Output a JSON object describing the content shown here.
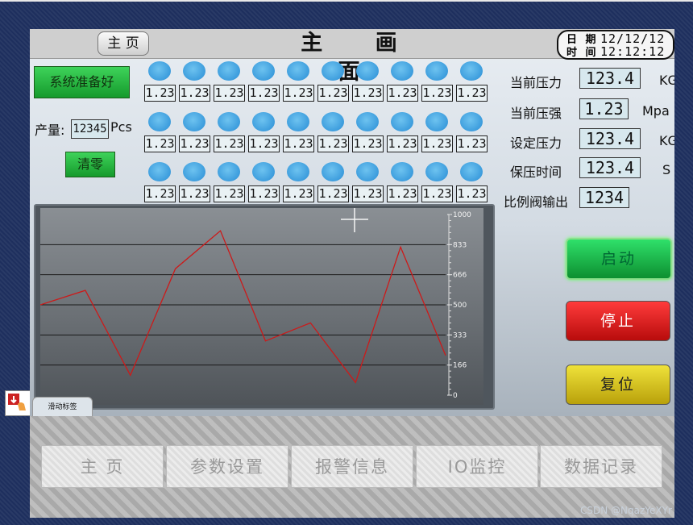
{
  "header": {
    "home_button": "主 页",
    "title": "主 画 面",
    "date_label": "日 期",
    "date_value": "12/12/12",
    "time_label": "时 间",
    "time_value": "12:12:12"
  },
  "left": {
    "ready_button": "系统准备好",
    "output_label": "产量:",
    "output_value": "12345",
    "output_unit": "Pcs",
    "clear_button": "清零"
  },
  "grid": {
    "cell_value": "1.23",
    "rows": 3,
    "cols": 10,
    "led_color": "#4aa8e4"
  },
  "readings": [
    {
      "label": "当前压力",
      "value": "123.4",
      "unit": "KG"
    },
    {
      "label": "当前压强",
      "value": "1.23",
      "unit": "Mpa"
    },
    {
      "label": "设定压力",
      "value": "123.4",
      "unit": "KG"
    },
    {
      "label": "保压时间",
      "value": "123.4",
      "unit": "S"
    },
    {
      "label": "比例阀输出",
      "value": "1234",
      "unit": ""
    }
  ],
  "chart_data": {
    "type": "line",
    "y_ticks": [
      "1000",
      "833",
      "666",
      "500",
      "333",
      "166",
      "0"
    ],
    "ylim": [
      0,
      1000
    ],
    "series": [
      {
        "values": [
          500,
          580,
          110,
          700,
          910,
          300,
          400,
          70,
          820,
          220
        ],
        "color": "#cc1a1a"
      }
    ],
    "tab_label": "滑动标签"
  },
  "buttons": {
    "start": "启动",
    "stop": "停止",
    "reset": "复位"
  },
  "nav": [
    "主 页",
    "参数设置",
    "报警信息",
    "IO监控",
    "数据记录"
  ],
  "watermark": "CSDN @NqazYeXYr"
}
